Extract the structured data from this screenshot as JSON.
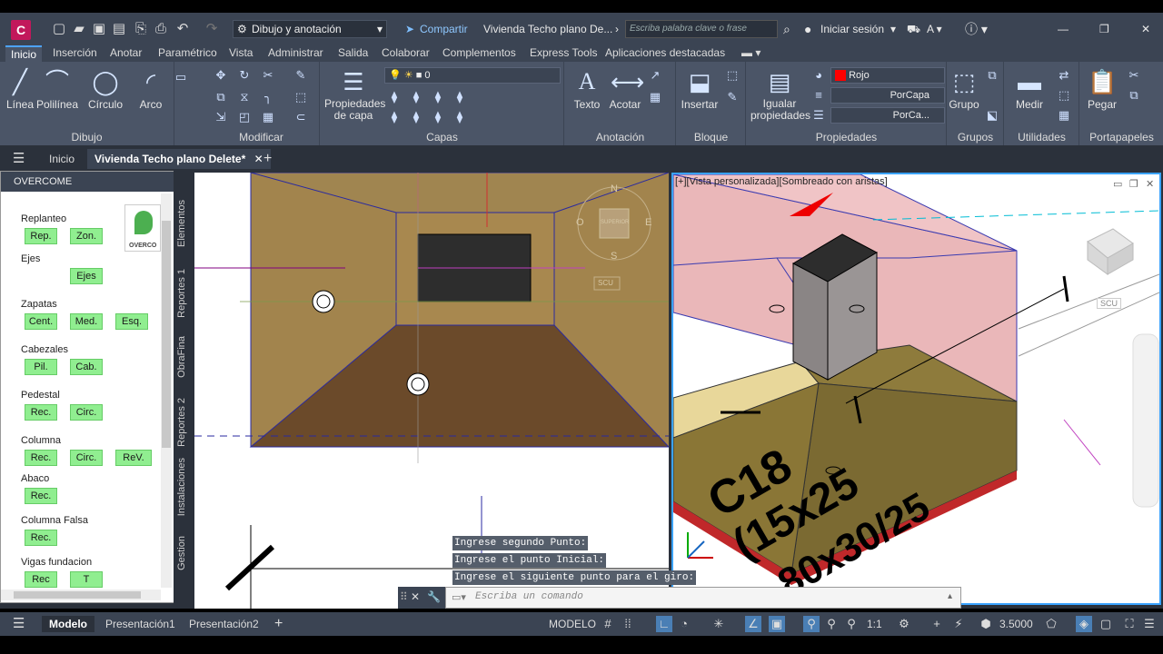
{
  "titlebar": {
    "app_letter": "C",
    "workspace": "Dibujo y anotación",
    "share": "Compartir",
    "doc_title": "Vivienda Techo plano De...",
    "search_placeholder": "Escriba palabra clave o frase",
    "signin": "Iniciar sesión"
  },
  "ribbon_tabs": [
    "Inicio",
    "Inserción",
    "Anotar",
    "Paramétrico",
    "Vista",
    "Administrar",
    "Salida",
    "Colaborar",
    "Complementos",
    "Express Tools",
    "Aplicaciones destacadas"
  ],
  "ribbon": {
    "draw": {
      "title": "Dibujo",
      "line": "Línea",
      "polyline": "Polilínea",
      "circle": "Círculo",
      "arc": "Arco"
    },
    "modify": {
      "title": "Modificar"
    },
    "layers": {
      "title": "Capas",
      "layer_props": "Propiedades de capa",
      "current_layer": "0"
    },
    "annotation": {
      "title": "Anotación",
      "text": "Texto",
      "dimension": "Acotar"
    },
    "block": {
      "title": "Bloque",
      "insert": "Insertar"
    },
    "properties": {
      "title": "Propiedades",
      "match": "Igualar propiedades",
      "color": "Rojo",
      "linetype": "PorCapa",
      "lineweight": "PorCa..."
    },
    "groups": {
      "title": "Grupos",
      "group": "Grupo"
    },
    "utilities": {
      "title": "Utilidades",
      "measure": "Medir"
    },
    "clipboard": {
      "title": "Portapapeles",
      "paste": "Pegar"
    }
  },
  "file_tabs": {
    "home": "Inicio",
    "drawing": "Vivienda Techo plano Delete*"
  },
  "palette": {
    "title": "OVERCOME",
    "logo_text": "OVERCO",
    "sections": [
      {
        "label": "Replanteo",
        "buttons": [
          "Rep.",
          "Zon."
        ]
      },
      {
        "label": "Ejes",
        "buttons": [
          "Ejes"
        ]
      },
      {
        "label": "Zapatas",
        "buttons": [
          "Cent.",
          "Med.",
          "Esq."
        ]
      },
      {
        "label": "Cabezales",
        "buttons": [
          "Pil.",
          "Cab."
        ]
      },
      {
        "label": "Pedestal",
        "buttons": [
          "Rec.",
          "Circ."
        ]
      },
      {
        "label": "Columna",
        "buttons": [
          "Rec.",
          "Circ.",
          "ReV."
        ]
      },
      {
        "label": "Abaco",
        "buttons": [
          "Rec."
        ]
      },
      {
        "label": "Columna Falsa",
        "buttons": [
          "Rec."
        ]
      },
      {
        "label": "Vigas fundacion",
        "buttons": [
          "Rec",
          "T"
        ]
      }
    ],
    "side_tabs": [
      "Elementos",
      "Reportes 1",
      "ObraFina",
      "Reportes 2",
      "Instalaciones",
      "Gestion"
    ]
  },
  "viewport_left": {
    "compass": {
      "n": "N",
      "s": "S",
      "e": "E",
      "o": "O",
      "center": "SUPERIOR"
    },
    "ucs": "SCU"
  },
  "viewport_right": {
    "label": "[+][Vista personalizada][Sombreado con aristas]",
    "ucs": "SCU",
    "annotation_line1": "C18",
    "annotation_line2": "(15x25",
    "annotation_line3": "80x30/25"
  },
  "command": {
    "history": [
      "Ingrese segundo Punto:",
      "Ingrese el punto Inicial:",
      "Ingrese el siguiente punto para el giro:"
    ],
    "placeholder": "Escriba un comando"
  },
  "status": {
    "model_tab": "Modelo",
    "layout1": "Presentación1",
    "layout2": "Presentación2",
    "mode": "MODELO",
    "scale": "1:1",
    "value": "3.5000"
  },
  "colors": {
    "accent": "#3aa3ff",
    "brand": "#c2185b",
    "palette_button": "#90ee90",
    "layer_red": "#ff0000"
  }
}
